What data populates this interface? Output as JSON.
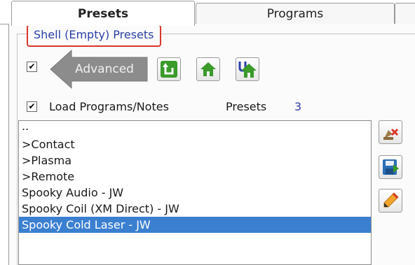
{
  "tabs": [
    {
      "label": "Presets",
      "active": true
    },
    {
      "label": "Programs",
      "active": false
    },
    {
      "label": "",
      "active": false
    }
  ],
  "group": {
    "title": "Shell (Empty) Presets"
  },
  "advanced": {
    "checked": true,
    "label": "Advanced"
  },
  "nav_icons": [
    "back-up-icon",
    "home-icon",
    "user-home-icon"
  ],
  "load": {
    "checked": true,
    "label": "Load Programs/Notes"
  },
  "presets": {
    "label": "Presets",
    "count": "3"
  },
  "list": {
    "items": [
      "..",
      ">Contact",
      ">Plasma",
      ">Remote",
      "Spooky Audio - JW",
      "Spooky Coil (XM Direct) - JW",
      "Spooky Cold Laser - JW"
    ],
    "selected_index": 6
  },
  "side_icons": [
    "delete-icon",
    "save-icon",
    "edit-icon"
  ],
  "colors": {
    "accent": "#2b3fa8",
    "selection": "#3b7fd0",
    "highlight_border": "#d9372b",
    "icon_green": "#3a9a2a"
  }
}
